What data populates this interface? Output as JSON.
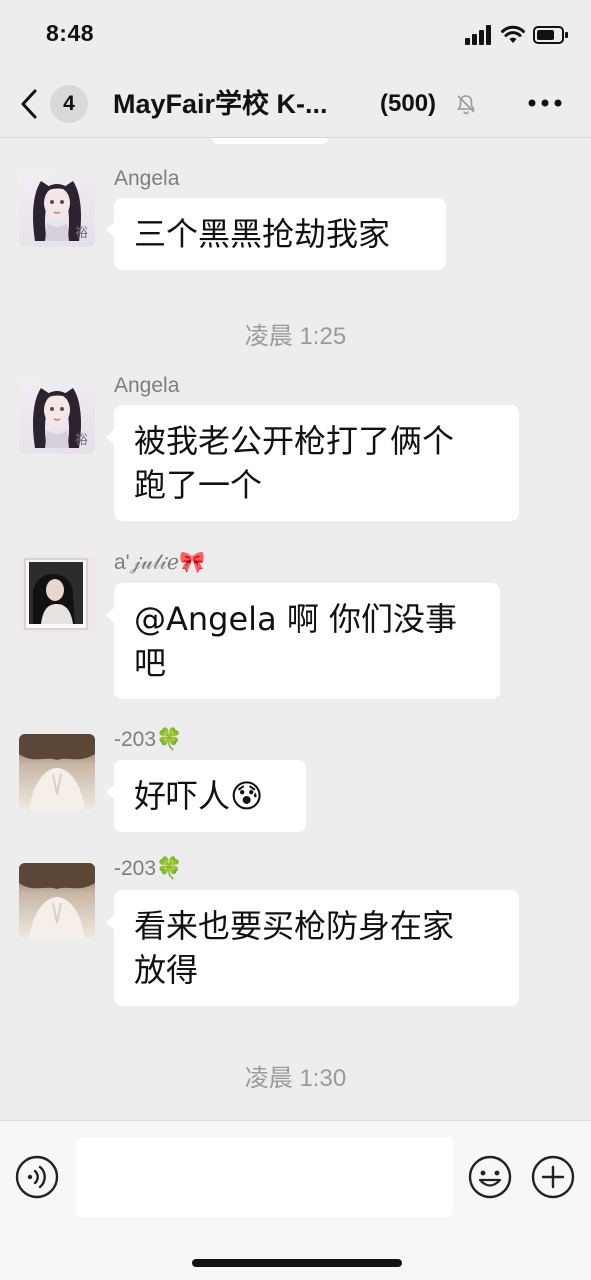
{
  "status_bar": {
    "time": "8:48"
  },
  "nav": {
    "back_label": "",
    "unread_count": "4",
    "title": "MayFair学校 K-...",
    "member_count": "(500)"
  },
  "messages": [
    {
      "sender": "Angela",
      "text": "三个黑黑抢劫我家"
    },
    {
      "timestamp": "凌晨 1:25"
    },
    {
      "sender": "Angela",
      "text": "被我老公开枪打了俩个\n跑了一个"
    },
    {
      "sender": "a'𝒿𝓊𝓁𝒾ℯ🎀",
      "text": "@Angela 啊 你们没事\n吧"
    },
    {
      "sender": "-203🍀",
      "text": "好吓人😰"
    },
    {
      "sender": "-203🍀",
      "text": "看来也要买枪防身在家\n放得"
    },
    {
      "timestamp": "凌晨 1:30"
    }
  ],
  "input": {
    "placeholder": ""
  },
  "colors": {
    "background": "#ededed",
    "bubble": "#ffffff",
    "sender": "#7e7e7e",
    "timestamp": "#9a9a9a"
  },
  "icons": [
    "back-chevron-icon",
    "mute-bell-icon",
    "more-dots-icon",
    "voice-icon",
    "emoji-icon",
    "plus-icon",
    "signal-icon",
    "wifi-icon",
    "battery-icon"
  ]
}
